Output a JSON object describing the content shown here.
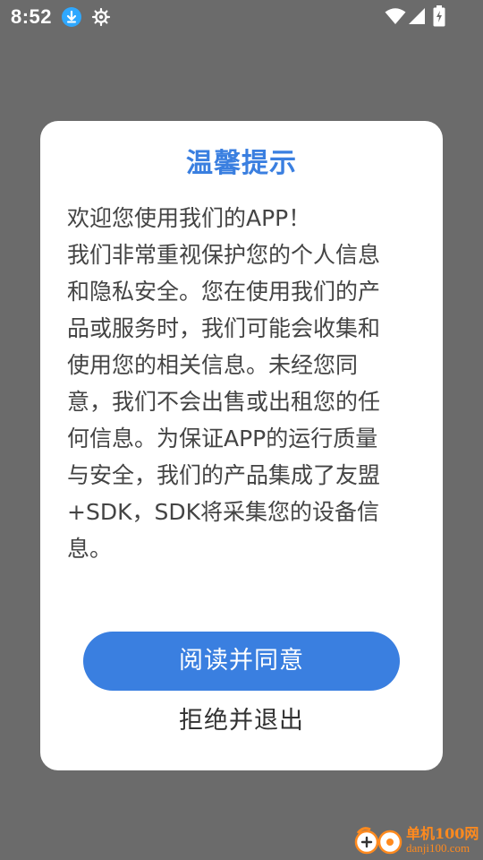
{
  "status_bar": {
    "time": "8:52",
    "icons": [
      "download-icon",
      "gear-icon",
      "wifi-icon",
      "signal-icon",
      "battery-charging-icon"
    ]
  },
  "dialog": {
    "title": "温馨提示",
    "body_lines": [
      "欢迎您使用我们的APP！",
      "我们非常重视保护您的个人信息",
      "和隐私安全。您在使用我们的产",
      "品或服务时，我们可能会收集和",
      "使用您的相关信息。未经您同",
      "意，我们不会出售或出租您的任",
      "何信息。为保证APP的运行质量",
      "与安全，我们的产品集成了友盟",
      "+SDK，SDK将采集您的设备信",
      "息。"
    ],
    "agree_label": "阅读并同意",
    "reject_label": "拒绝并退出"
  },
  "watermark": {
    "name": "单机100网",
    "domain": "danji100.com"
  },
  "colors": {
    "accent": "#3a7fe0",
    "overlay": "#6b6b6b",
    "dialog_bg": "#ffffff",
    "body_text": "#444444",
    "watermark": "#ff8a1e"
  }
}
